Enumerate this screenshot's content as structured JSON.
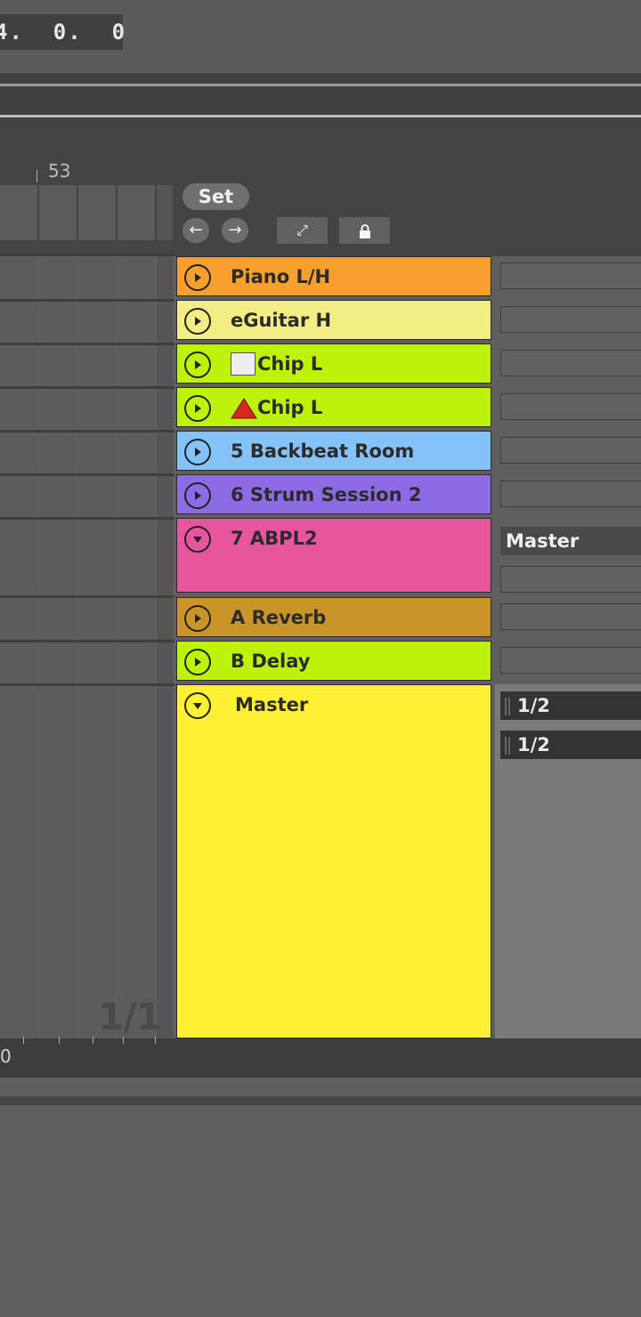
{
  "transport": {
    "position": "4.  0.  0"
  },
  "ruler": {
    "bar_label": "53"
  },
  "header": {
    "set_label": "Set",
    "nav_back_icon": "arrow-left-icon",
    "nav_forward_icon": "arrow-right-icon",
    "expand_icon": "resize-diagonal-icon",
    "lock_icon": "lock-icon"
  },
  "tracks": [
    {
      "name": "Piano L/H",
      "color": "#f7a02d",
      "state": "collapsed"
    },
    {
      "name": "eGuitar H",
      "color": "#f3ed86",
      "state": "collapsed"
    },
    {
      "name": "Chip L",
      "prefix_icon": "white-square-icon",
      "color": "#bdf20b",
      "state": "collapsed"
    },
    {
      "name": "Chip L",
      "prefix_icon": "red-warning-triangle-icon",
      "color": "#bdf20b",
      "state": "collapsed"
    },
    {
      "name": "5 Backbeat Room",
      "color": "#85c2f7",
      "state": "collapsed"
    },
    {
      "name": "6 Strum Session 2",
      "color": "#8c6be4",
      "state": "collapsed"
    },
    {
      "name": "7 ABPL2",
      "color": "#e8559f",
      "state": "expanded"
    },
    {
      "name": "A Reverb",
      "color": "#c99428",
      "state": "collapsed"
    },
    {
      "name": "B Delay",
      "color": "#bdf20b",
      "state": "collapsed"
    },
    {
      "name": "Master",
      "color": "#fff033",
      "state": "expanded"
    }
  ],
  "io": {
    "abpl2_output": "Master",
    "master_cue_1": "1/2",
    "master_cue_2": "1/2"
  },
  "footer": {
    "scale_start": "0",
    "pager": "1/1"
  }
}
